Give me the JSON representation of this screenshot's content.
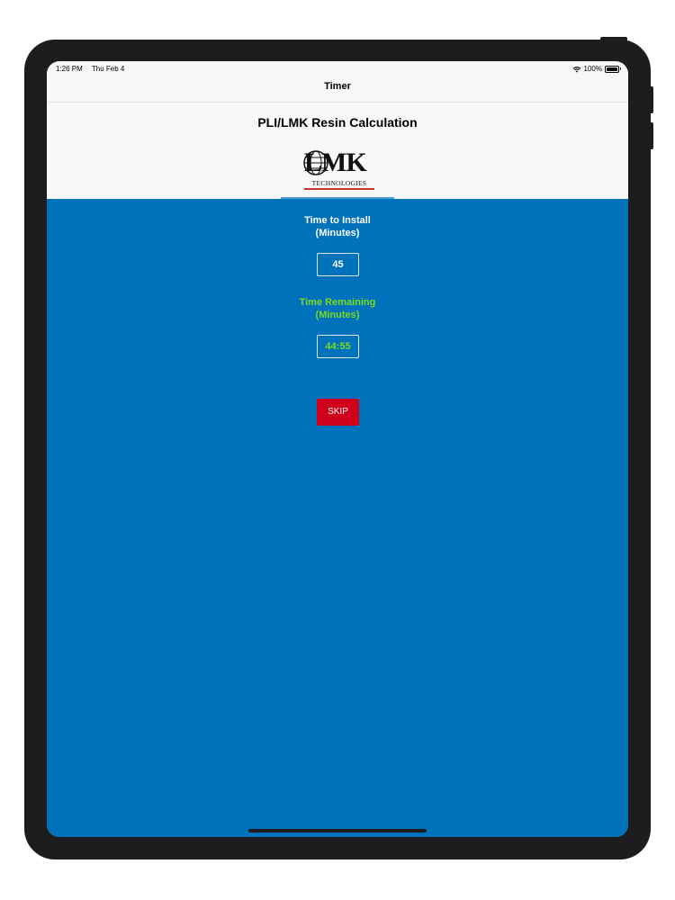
{
  "status_bar": {
    "time": "1:26 PM",
    "date": "Thu Feb 4",
    "battery": "100%",
    "wifi_icon": "wifi-icon",
    "battery_icon": "battery-icon"
  },
  "nav": {
    "title": "Timer"
  },
  "header": {
    "title": "PLI/LMK Resin Calculation",
    "logo_text": "LMK",
    "logo_subtext": "TECHNOLOGIES"
  },
  "install": {
    "label_line1": "Time to Install",
    "label_line2": "(Minutes)",
    "value": "45"
  },
  "remaining": {
    "label_line1": "Time Remaining",
    "label_line2": "(Minutes)",
    "value": "44:55"
  },
  "skip_button": {
    "label": "SKIP"
  },
  "colors": {
    "background_blue": "#0071bb",
    "accent_green": "#7ddc1f",
    "skip_red": "#d0021b"
  }
}
